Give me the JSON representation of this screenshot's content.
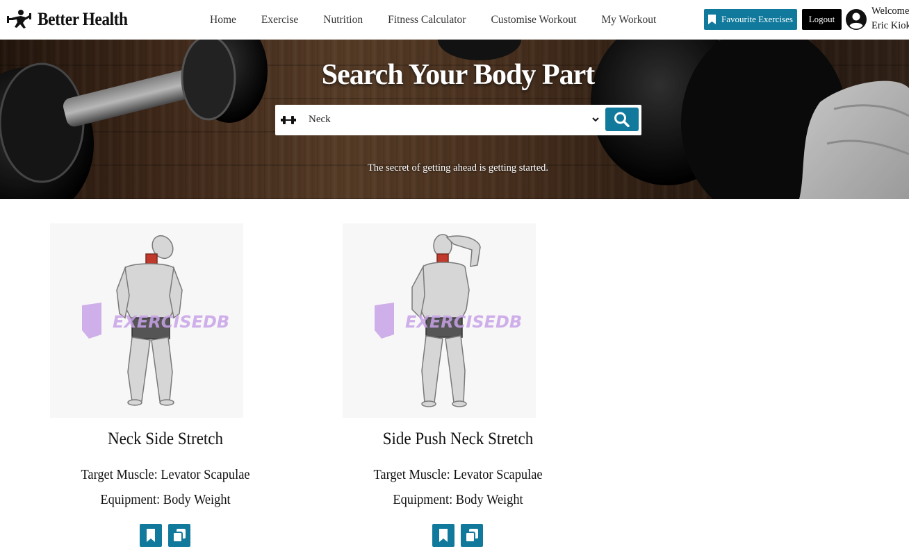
{
  "brand": {
    "name": "Better Health",
    "logo_icon": "fitness-figure-icon"
  },
  "nav": {
    "links": [
      "Home",
      "Exercise",
      "Nutrition",
      "Fitness Calculator",
      "Customise Workout",
      "My Workout"
    ]
  },
  "header_actions": {
    "favourite_label": "Favourite Exercises",
    "favourite_icon": "bookmark-icon",
    "logout_label": "Logout",
    "user_icon": "user-circle-icon",
    "welcome_line1": "Welcome",
    "welcome_line2": "Eric Kioko"
  },
  "hero": {
    "title": "Search Your Body Part",
    "search": {
      "selected": "Neck",
      "icon": "dumbbell-icon",
      "button_icon": "search-icon"
    },
    "tagline": "The secret of getting ahead is getting started."
  },
  "exercises": [
    {
      "title": "Neck Side Stretch",
      "target": "Target Muscle: Levator Scapulae",
      "equipment": "Equipment: Body Weight",
      "watermark": "EXERCISEDB"
    },
    {
      "title": "Side Push Neck Stretch",
      "target": "Target Muscle: Levator Scapulae",
      "equipment": "Equipment: Body Weight",
      "watermark": "EXERCISEDB"
    }
  ],
  "colors": {
    "accent": "#117a9c",
    "logout": "#000000",
    "highlight_muscle": "#c0392b",
    "watermark": "#c9a3e8"
  }
}
